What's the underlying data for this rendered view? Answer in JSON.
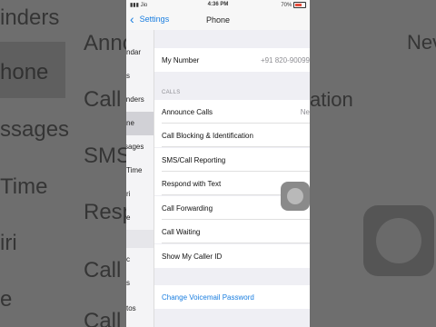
{
  "background": {
    "left_rows": [
      "inders",
      "Annou",
      "hone",
      "Call B",
      "ssages",
      "SMS/",
      "Time",
      "Resp",
      "iri",
      "Call F",
      "e",
      "Call V"
    ],
    "right_rows": [
      "Nev",
      "ation"
    ]
  },
  "status": {
    "carrier": "Jio",
    "time": "4:36 PM",
    "battery": "70%"
  },
  "nav": {
    "back_label": "Settings",
    "title": "Phone"
  },
  "sliver": {
    "items": [
      "ndar",
      "s",
      "inders",
      "ne",
      "sages",
      "Time",
      "ri",
      "e",
      "c",
      "s",
      "tos"
    ]
  },
  "my_number": {
    "label": "My Number",
    "value": "+91 820-90099"
  },
  "calls": {
    "header": "CALLS",
    "announce": {
      "label": "Announce Calls",
      "value": "Ne"
    },
    "items": [
      "Call Blocking & Identification",
      "SMS/Call Reporting",
      "Respond with Text",
      "Call Forwarding",
      "Call Waiting",
      "Show My Caller ID"
    ]
  },
  "voicemail": {
    "label": "Change Voicemail Password"
  }
}
